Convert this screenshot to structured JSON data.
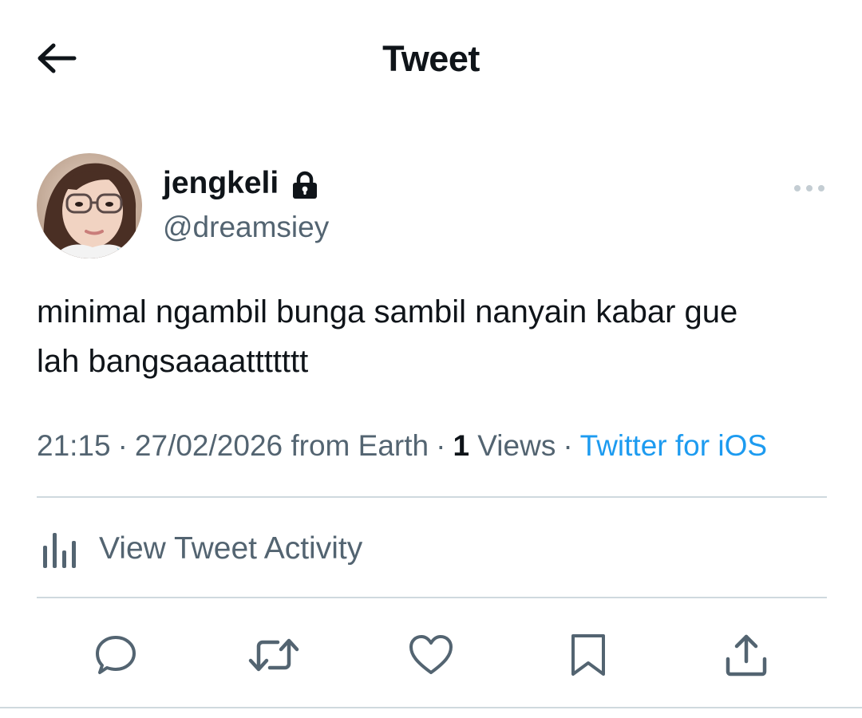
{
  "header": {
    "title": "Tweet",
    "back_icon": "arrow-left-icon"
  },
  "tweet": {
    "author": {
      "display_name": "jengkeli",
      "handle": "@dreamsiey",
      "protected": true
    },
    "text_line1": "minimal ngambil bunga sambil nanyain kabar gue",
    "text_line2": "lah bangsaaaattttttt",
    "meta": {
      "time": "21:15",
      "date": "27/02/2026 from Earth",
      "views_count": "1",
      "views_label": "Views",
      "source": "Twitter for iOS",
      "separator": "·"
    },
    "activity_label": "View Tweet Activity"
  },
  "colors": {
    "text": "#0f1419",
    "secondary": "#536471",
    "accent": "#1d9bf0",
    "divider": "#cfd9de"
  },
  "actions": [
    "reply-icon",
    "retweet-icon",
    "like-icon",
    "bookmark-icon",
    "share-icon"
  ]
}
